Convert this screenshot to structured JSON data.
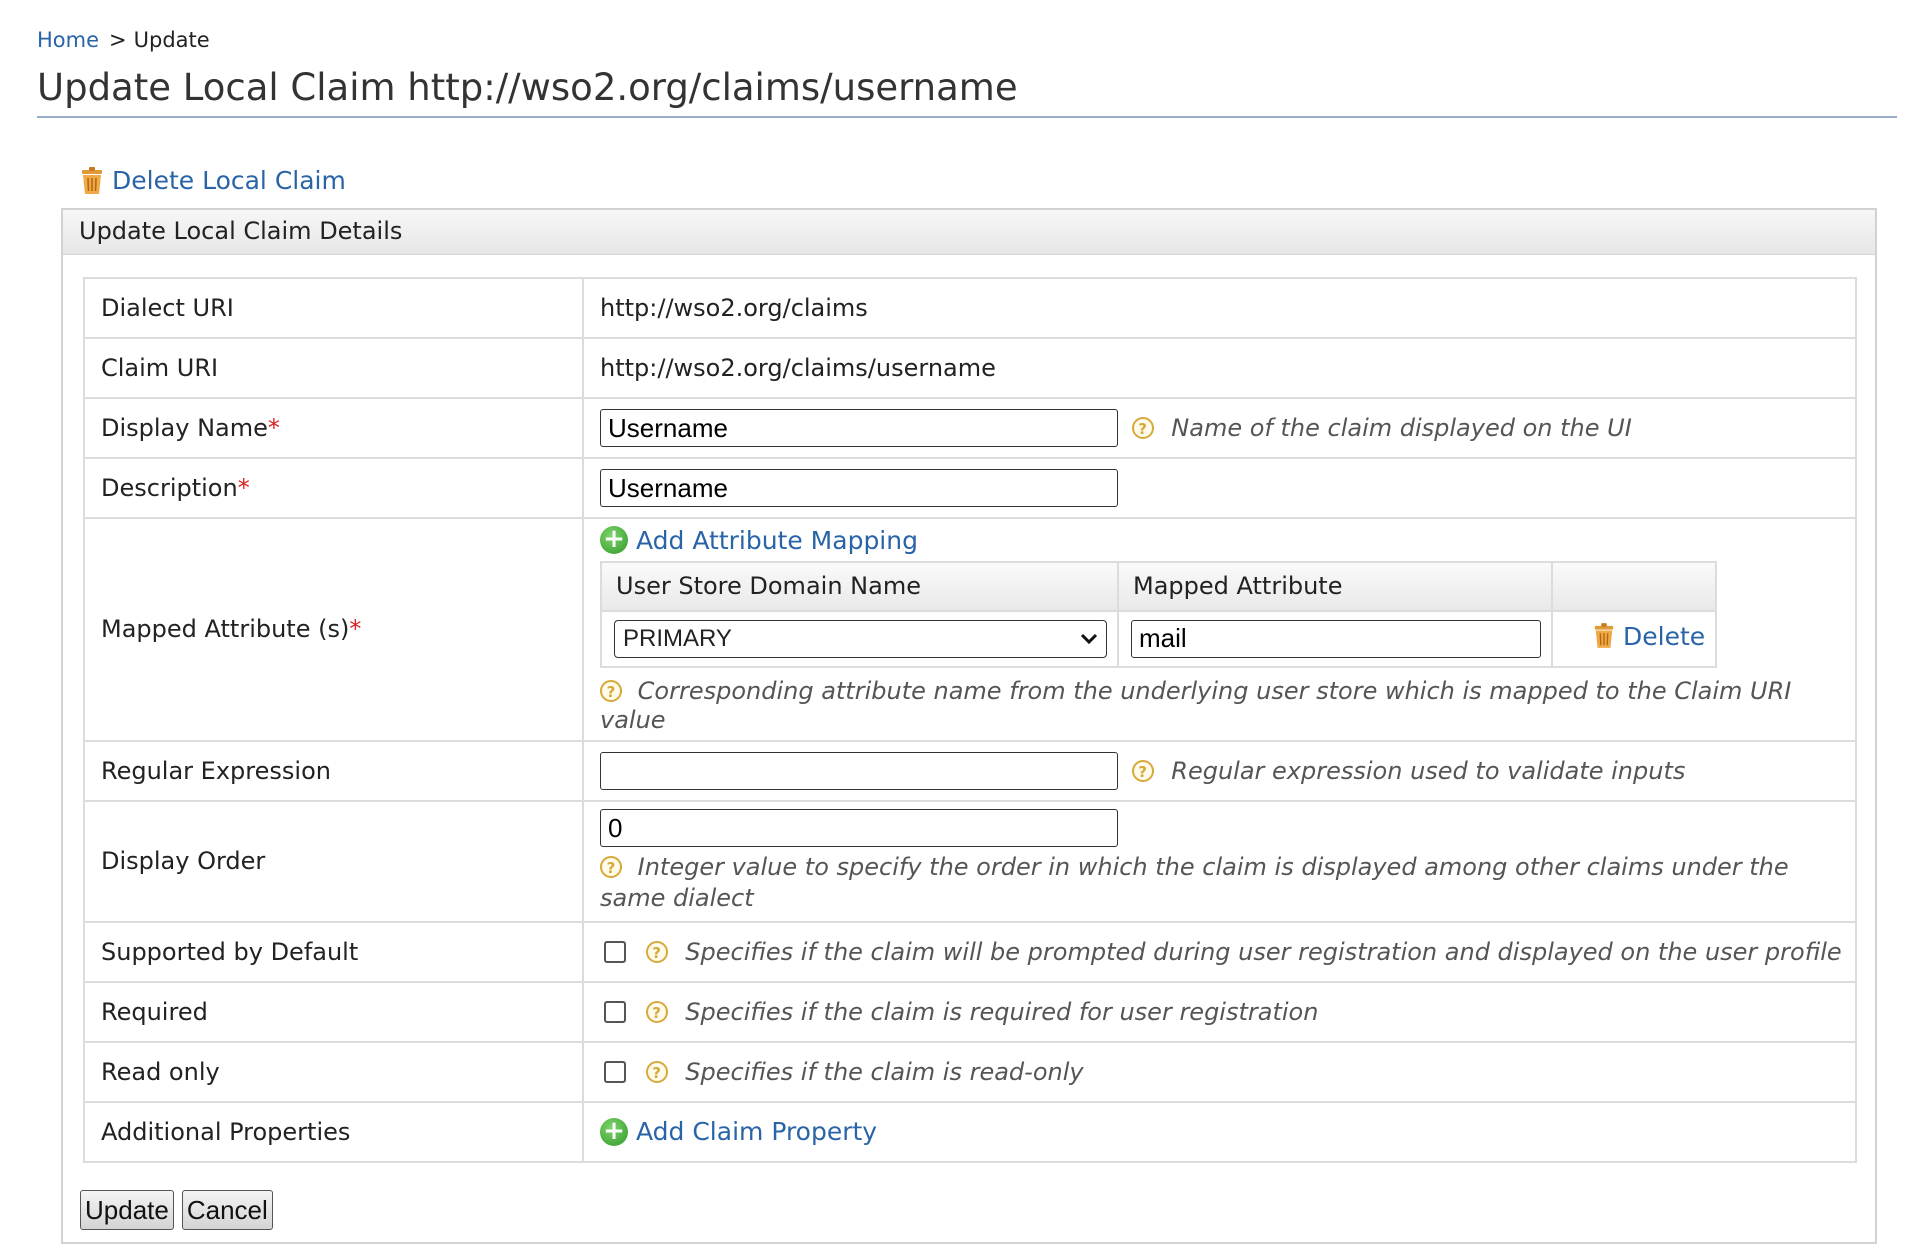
{
  "breadcrumb": {
    "home": "Home",
    "separator": ">",
    "current": "Update"
  },
  "page_title": "Update Local Claim http://wso2.org/claims/username",
  "delete_local_claim": "Delete Local Claim",
  "panel_title": "Update Local Claim Details",
  "rows": {
    "dialect_uri": {
      "label": "Dialect URI",
      "value": "http://wso2.org/claims"
    },
    "claim_uri": {
      "label": "Claim URI",
      "value": "http://wso2.org/claims/username"
    },
    "display_name": {
      "label": "Display Name",
      "required_mark": "*",
      "value": "Username",
      "hint": "Name of the claim displayed on the UI"
    },
    "description": {
      "label": "Description",
      "required_mark": "*",
      "value": "Username"
    },
    "mapped_attributes": {
      "label": "Mapped Attribute (s)",
      "required_mark": "*",
      "add_link": "Add Attribute Mapping",
      "col_domain": "User Store Domain Name",
      "col_attribute": "Mapped Attribute",
      "domain_value": "PRIMARY",
      "attribute_value": "mail",
      "delete_link": "Delete",
      "hint": "Corresponding attribute name from the underlying user store which is mapped to the Claim URI value"
    },
    "regex": {
      "label": "Regular Expression",
      "value": "",
      "hint": "Regular expression used to validate inputs"
    },
    "display_order": {
      "label": "Display Order",
      "value": "0",
      "hint": "Integer value to specify the order in which the claim is displayed among other claims under the same dialect"
    },
    "supported_by_default": {
      "label": "Supported by Default",
      "checked": false,
      "hint": "Specifies if the claim will be prompted during user registration and displayed on the user profile"
    },
    "required": {
      "label": "Required",
      "checked": false,
      "hint": "Specifies if the claim is required for user registration"
    },
    "read_only": {
      "label": "Read only",
      "checked": false,
      "hint": "Specifies if the claim is read-only"
    },
    "additional_properties": {
      "label": "Additional Properties",
      "add_link": "Add Claim Property"
    }
  },
  "buttons": {
    "update": "Update",
    "cancel": "Cancel"
  },
  "colors": {
    "link": "#2a64a8",
    "required": "#dd2222",
    "help_icon": "#d7a93b",
    "add_icon": "#2f9a2a"
  },
  "icons": {
    "delete": "trash-icon",
    "help": "help-icon",
    "add": "plus-circle-icon",
    "select": "chevron-down-icon"
  }
}
